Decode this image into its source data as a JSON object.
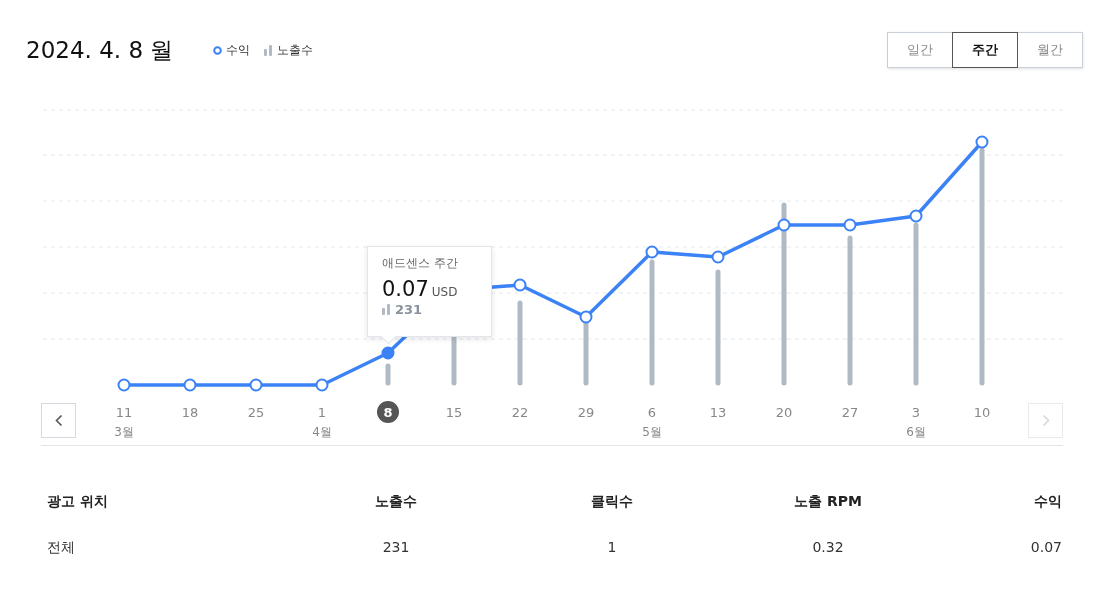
{
  "title": "2024. 4. 8 월",
  "legend": [
    {
      "kind": "line",
      "label": "수익"
    },
    {
      "kind": "bar",
      "label": "노출수"
    }
  ],
  "periods": [
    {
      "label": "일간",
      "selected": false
    },
    {
      "label": "주간",
      "selected": true
    },
    {
      "label": "월간",
      "selected": false
    }
  ],
  "chart": {
    "prev": {
      "disabled": false
    },
    "next": {
      "disabled": true
    },
    "x_labels": [
      {
        "day": "11",
        "month": "3월",
        "selected": false
      },
      {
        "day": "18",
        "selected": false
      },
      {
        "day": "25",
        "selected": false
      },
      {
        "day": "1",
        "month": "4월",
        "selected": false
      },
      {
        "day": "8",
        "selected": true
      },
      {
        "day": "15",
        "selected": false
      },
      {
        "day": "22",
        "selected": false
      },
      {
        "day": "29",
        "selected": false
      },
      {
        "day": "6",
        "month": "5월",
        "selected": false
      },
      {
        "day": "13",
        "selected": false
      },
      {
        "day": "20",
        "selected": false
      },
      {
        "day": "27",
        "selected": false
      },
      {
        "day": "3",
        "month": "6월",
        "selected": false
      },
      {
        "day": "10",
        "selected": false
      }
    ],
    "tooltip": {
      "title": "애드센스 주간",
      "value": "0.07",
      "unit": "USD",
      "impressions": "231"
    }
  },
  "table": {
    "columns": [
      "광고 위치",
      "노출수",
      "클릭수",
      "노출 RPM",
      "수익"
    ],
    "rows": [
      [
        "전체",
        "231",
        "1",
        "0.32",
        "0.07"
      ]
    ]
  }
}
